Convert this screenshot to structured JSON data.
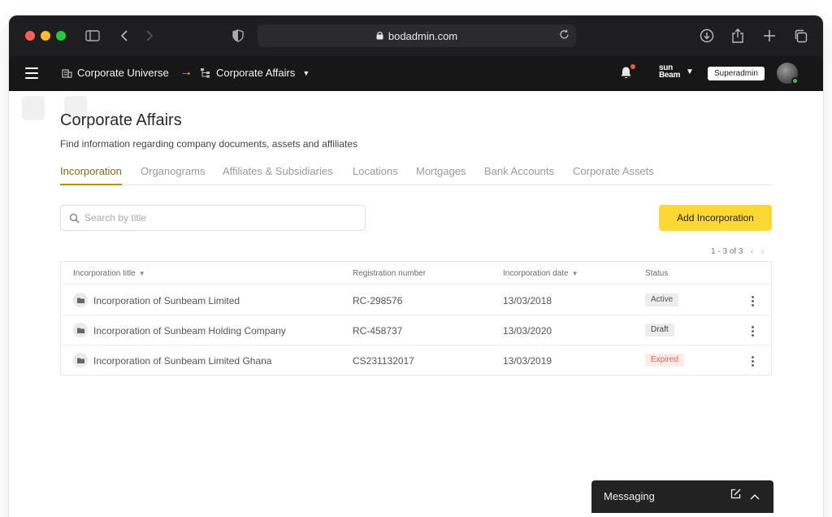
{
  "browser": {
    "url": "bodadmin.com"
  },
  "header": {
    "breadcrumb_root": "Corporate Universe",
    "breadcrumb_current": "Corporate Affairs",
    "arrow": "→",
    "brand_line1": "sun",
    "brand_line2": "Beam",
    "role": "Superadmin"
  },
  "page": {
    "title": "Corporate Affairs",
    "subtitle": "Find information regarding company documents, assets and affiliates"
  },
  "tabs": [
    {
      "label": "Incorporation",
      "active": true
    },
    {
      "label": "Organograms"
    },
    {
      "label": "Affiliates & Subsidiaries"
    },
    {
      "label": "Locations"
    },
    {
      "label": "Mortgages"
    },
    {
      "label": "Bank Accounts"
    },
    {
      "label": "Corporate Assets"
    }
  ],
  "search": {
    "placeholder": "Search by title"
  },
  "actions": {
    "add_label": "Add Incorporation"
  },
  "pagination": {
    "text": "1 - 3 of 3"
  },
  "table": {
    "columns": [
      "Incorporation title",
      "Registration number",
      "Incorporation date",
      "Status"
    ],
    "rows": [
      {
        "title": "Incorporation of Sunbeam Limited",
        "reg": "RC-298576",
        "date": "13/03/2018",
        "status": "Active"
      },
      {
        "title": "Incorporation of Sunbeam Holding Company",
        "reg": "RC-458737",
        "date": "13/03/2020",
        "status": "Draft"
      },
      {
        "title": "Incorporation of Sunbeam Limited Ghana",
        "reg": "CS231132017",
        "date": "13/03/2019",
        "status": "Expired"
      }
    ]
  },
  "messaging": {
    "label": "Messaging"
  },
  "colors": {
    "accent": "#fdd835",
    "active_tab": "#8a6d12",
    "header_bg": "#171717"
  }
}
